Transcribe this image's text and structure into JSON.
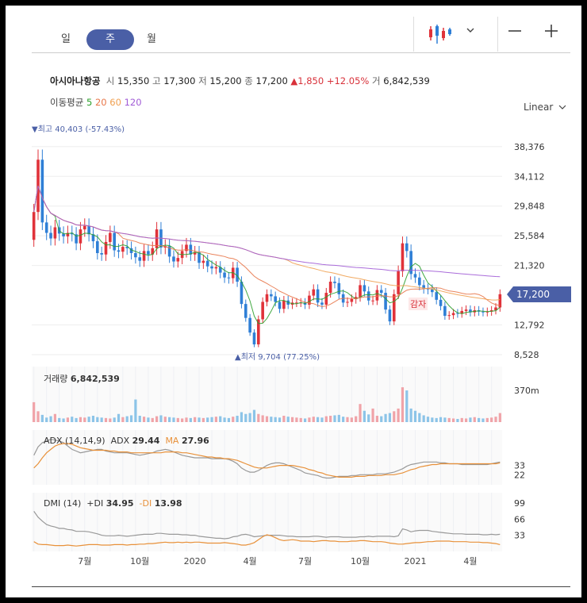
{
  "tabs": [
    "일",
    "주",
    "월"
  ],
  "active_tab": "주",
  "toolbar": {
    "chart_icon": "candlestick-icon",
    "dropdown_icon": "chevron-down-icon",
    "zoom_out": "—",
    "zoom_in": "+"
  },
  "stock": {
    "name": "아시아나항공",
    "open_label": "시",
    "open": "15,350",
    "high_label": "고",
    "high": "17,300",
    "low_label": "저",
    "low": "15,200",
    "close_label": "종",
    "close": "17,200",
    "change": "▲1,850",
    "change_pct": "+12.05%",
    "volume_label": "거",
    "volume": "6,842,539"
  },
  "ma": {
    "label": "이동평균",
    "periods": [
      "5",
      "20",
      "60",
      "120"
    ],
    "colors": [
      "#2ca02c",
      "#e8774a",
      "#f0a050",
      "#a15cd6"
    ]
  },
  "scale": "Linear",
  "price_axis": {
    "ticks": [
      "38,376",
      "34,112",
      "29,848",
      "25,584",
      "21,320",
      "12,792",
      "8,528"
    ],
    "current": "17,200",
    "high_marker": "▼최고 40,403 (-57.43%)",
    "low_marker": "▲최저 9,704 (77.25%)",
    "annotation": "감자"
  },
  "volume_panel": {
    "label": "거래량",
    "value": "6,842,539",
    "tick": "370m"
  },
  "adx_panel": {
    "label": "ADX (14,14,9)",
    "adx_label": "ADX",
    "adx_value": "29.44",
    "ma_label": "MA",
    "ma_value": "27.96",
    "ticks": [
      "33",
      "22"
    ]
  },
  "dmi_panel": {
    "label": "DMI (14)",
    "pdi_label": "+DI",
    "pdi_value": "34.95",
    "mdi_label": "-DI",
    "mdi_value": "13.98",
    "ticks": [
      "99",
      "66",
      "33"
    ]
  },
  "x_axis": [
    "7월",
    "10월",
    "2020",
    "4월",
    "7월",
    "10월",
    "2021",
    "4월"
  ],
  "colors": {
    "up": "#e0323a",
    "down": "#2f7fd6",
    "accent": "#4a5fa6",
    "volume_up": "#f0a3a8",
    "volume_down": "#8cc4e8"
  },
  "chart_data": {
    "type": "candlestick",
    "ylim": [
      8528,
      40403
    ],
    "x": [
      "7월",
      "10월",
      "2020",
      "4월",
      "7월",
      "10월",
      "2021",
      "4월"
    ],
    "close": [
      29000,
      36500,
      27500,
      26000,
      25200,
      26800,
      25900,
      25500,
      26000,
      25800,
      24500,
      26500,
      27000,
      25800,
      24800,
      23100,
      22900,
      24700,
      26000,
      23500,
      23300,
      24000,
      23800,
      23100,
      22500,
      22000,
      23400,
      22900,
      23800,
      26500,
      23900,
      24100,
      22600,
      21900,
      22400,
      23400,
      24300,
      22900,
      23200,
      21700,
      22000,
      21200,
      20900,
      21100,
      20300,
      19600,
      19500,
      21000,
      19000,
      15800,
      13800,
      11700,
      10000,
      13600,
      16100,
      17200,
      16900,
      16100,
      15100,
      16300,
      15700,
      16000,
      16000,
      16000,
      15700,
      17000,
      17900,
      16000,
      15700,
      17400,
      19000,
      18800,
      17200,
      16000,
      16100,
      16500,
      16800,
      18500,
      17600,
      16300,
      16300,
      17800,
      17400,
      15000,
      13300,
      17200,
      20500,
      24500,
      23400,
      20100,
      19600,
      18500,
      18000,
      17900,
      17500,
      16400,
      15500,
      14100,
      14200,
      14500,
      14400,
      14800,
      15000,
      14600,
      14900,
      14700,
      14600,
      14700,
      14900,
      15300,
      17200
    ],
    "volume_m": [
      44,
      24,
      16,
      10,
      13,
      18,
      9,
      8,
      10,
      12,
      9,
      11,
      10,
      12,
      14,
      11,
      10,
      9,
      8,
      10,
      18,
      11,
      13,
      15,
      50,
      14,
      12,
      10,
      9,
      13,
      15,
      12,
      11,
      10,
      9,
      8,
      10,
      9,
      11,
      10,
      9,
      10,
      11,
      12,
      13,
      10,
      9,
      12,
      14,
      22,
      18,
      20,
      27,
      18,
      15,
      13,
      12,
      11,
      10,
      14,
      12,
      11,
      10,
      9,
      8,
      10,
      12,
      11,
      10,
      13,
      14,
      15,
      16,
      12,
      11,
      10,
      13,
      40,
      25,
      17,
      30,
      14,
      13,
      18,
      20,
      24,
      30,
      77,
      70,
      30,
      25,
      20,
      15,
      12,
      10,
      9,
      11,
      10,
      9,
      8,
      7,
      9,
      8,
      10,
      11,
      9,
      8,
      9,
      10,
      12,
      20
    ],
    "adx": [
      45,
      55,
      60,
      62,
      64,
      63,
      62,
      60,
      56,
      52,
      50,
      48,
      49,
      50,
      51,
      52,
      52,
      50,
      49,
      48,
      48,
      48,
      48,
      47,
      46,
      45,
      46,
      47,
      48,
      50,
      51,
      52,
      51,
      49,
      47,
      45,
      44,
      43,
      42,
      42,
      42,
      42,
      41,
      41,
      41,
      41,
      40,
      38,
      35,
      30,
      27,
      25,
      25,
      27,
      30,
      33,
      35,
      36,
      36,
      35,
      33,
      31,
      29,
      27,
      24,
      23,
      22,
      21,
      19,
      18,
      18,
      19,
      20,
      20,
      20,
      21,
      21,
      22,
      22,
      22,
      22,
      23,
      23,
      23,
      24,
      25,
      27,
      29,
      32,
      34,
      35,
      36,
      37,
      37,
      37,
      37,
      36,
      36,
      35,
      35,
      35,
      34,
      34,
      34,
      34,
      34,
      34,
      34,
      35,
      36,
      37
    ],
    "adx_ma": [
      30,
      35,
      42,
      48,
      52,
      56,
      58,
      59,
      59,
      58,
      56,
      54,
      53,
      52,
      51,
      51,
      51,
      51,
      50,
      50,
      49,
      49,
      49,
      48,
      48,
      48,
      48,
      48,
      48,
      48,
      48,
      49,
      49,
      49,
      49,
      48,
      48,
      47,
      46,
      45,
      44,
      43,
      43,
      42,
      42,
      41,
      41,
      40,
      39,
      37,
      35,
      33,
      31,
      30,
      30,
      30,
      31,
      32,
      33,
      33,
      33,
      33,
      32,
      31,
      30,
      28,
      27,
      25,
      24,
      22,
      21,
      20,
      19,
      19,
      19,
      19,
      20,
      20,
      20,
      21,
      21,
      21,
      21,
      22,
      22,
      22,
      23,
      24,
      26,
      28,
      29,
      31,
      32,
      33,
      34,
      34,
      35,
      35,
      35,
      35,
      35,
      35,
      35,
      35,
      35,
      35,
      35,
      35,
      35,
      35,
      36
    ],
    "plus_di": [
      82,
      70,
      62,
      55,
      52,
      50,
      47,
      47,
      45,
      44,
      41,
      41,
      41,
      40,
      38,
      36,
      33,
      32,
      32,
      32,
      33,
      32,
      31,
      32,
      33,
      34,
      35,
      35,
      35,
      37,
      37,
      36,
      35,
      35,
      35,
      34,
      34,
      33,
      33,
      31,
      30,
      29,
      28,
      27,
      27,
      26,
      27,
      30,
      31,
      34,
      35,
      33,
      30,
      31,
      32,
      33,
      33,
      33,
      33,
      32,
      31,
      31,
      30,
      30,
      30,
      30,
      31,
      31,
      30,
      29,
      30,
      30,
      30,
      29,
      29,
      29,
      29,
      30,
      30,
      31,
      30,
      31,
      31,
      31,
      31,
      30,
      32,
      46,
      44,
      40,
      42,
      43,
      43,
      43,
      41,
      40,
      39,
      38,
      37,
      36,
      36,
      36,
      35,
      35,
      35,
      35,
      34,
      34,
      35,
      34,
      35
    ],
    "minus_di": [
      20,
      15,
      14,
      14,
      13,
      12,
      12,
      12,
      13,
      12,
      11,
      12,
      13,
      14,
      14,
      14,
      13,
      13,
      13,
      14,
      14,
      14,
      13,
      14,
      14,
      15,
      15,
      16,
      16,
      17,
      18,
      19,
      18,
      18,
      19,
      18,
      19,
      18,
      19,
      19,
      18,
      17,
      17,
      17,
      17,
      18,
      17,
      16,
      15,
      13,
      13,
      15,
      18,
      24,
      30,
      34,
      32,
      28,
      24,
      22,
      23,
      24,
      23,
      21,
      21,
      21,
      20,
      21,
      22,
      22,
      21,
      21,
      20,
      20,
      20,
      21,
      21,
      22,
      22,
      21,
      20,
      20,
      20,
      19,
      17,
      16,
      15,
      15,
      16,
      17,
      18,
      18,
      19,
      20,
      20,
      21,
      21,
      21,
      21,
      20,
      20,
      20,
      20,
      19,
      19,
      19,
      18,
      18,
      17,
      16,
      14
    ]
  }
}
